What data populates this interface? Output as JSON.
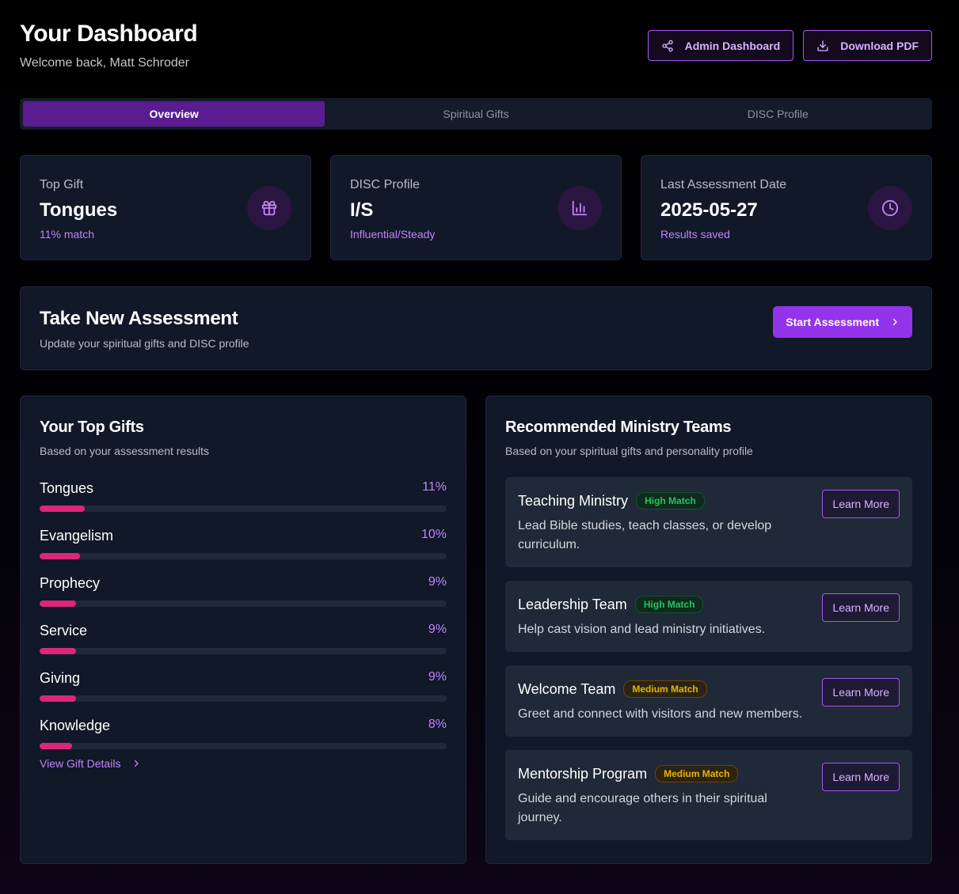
{
  "header": {
    "title": "Your Dashboard",
    "welcome": "Welcome back, Matt Schroder",
    "admin_button": "Admin Dashboard",
    "download_button": "Download PDF"
  },
  "tabs": [
    {
      "label": "Overview",
      "active": true
    },
    {
      "label": "Spiritual Gifts",
      "active": false
    },
    {
      "label": "DISC Profile",
      "active": false
    }
  ],
  "stats": [
    {
      "label": "Top Gift",
      "value": "Tongues",
      "sub": "11% match",
      "icon": "gift-icon"
    },
    {
      "label": "DISC Profile",
      "value": "I/S",
      "sub": "Influential/Steady",
      "icon": "bar-chart-icon"
    },
    {
      "label": "Last Assessment Date",
      "value": "2025-05-27",
      "sub": "Results saved",
      "icon": "clock-icon"
    }
  ],
  "assessment": {
    "title": "Take New Assessment",
    "subtitle": "Update your spiritual gifts and DISC profile",
    "button": "Start Assessment"
  },
  "top_gifts": {
    "title": "Your Top Gifts",
    "subtitle": "Based on your assessment results",
    "items": [
      {
        "name": "Tongues",
        "percent": "11%",
        "value": 11
      },
      {
        "name": "Evangelism",
        "percent": "10%",
        "value": 10
      },
      {
        "name": "Prophecy",
        "percent": "9%",
        "value": 9
      },
      {
        "name": "Service",
        "percent": "9%",
        "value": 9
      },
      {
        "name": "Giving",
        "percent": "9%",
        "value": 9
      },
      {
        "name": "Knowledge",
        "percent": "8%",
        "value": 8
      }
    ],
    "link": "View Gift Details"
  },
  "ministry": {
    "title": "Recommended Ministry Teams",
    "subtitle": "Based on your spiritual gifts and personality profile",
    "teams": [
      {
        "name": "Teaching Ministry",
        "match": "High Match",
        "level": "high",
        "description": "Lead Bible studies, teach classes, or develop curriculum.",
        "button": "Learn More"
      },
      {
        "name": "Leadership Team",
        "match": "High Match",
        "level": "high",
        "description": "Help cast vision and lead ministry initiatives.",
        "button": "Learn More"
      },
      {
        "name": "Welcome Team",
        "match": "Medium Match",
        "level": "medium",
        "description": "Greet and connect with visitors and new members.",
        "button": "Learn More"
      },
      {
        "name": "Mentorship Program",
        "match": "Medium Match",
        "level": "medium",
        "description": "Guide and encourage others in their spiritual journey.",
        "button": "Learn More"
      }
    ]
  },
  "colors": {
    "accent": "#9333ea",
    "accent_text": "#c084fc",
    "progress": "#db2777",
    "high_match": "#22c55e",
    "medium_match": "#eab308"
  }
}
